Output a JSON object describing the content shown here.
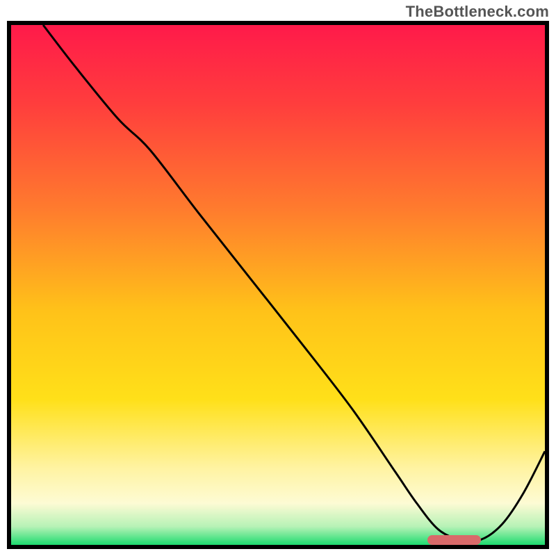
{
  "watermark": "TheBottleneck.com",
  "colors": {
    "frame": "#000000",
    "gradient_stops": [
      {
        "offset": 0.0,
        "color": "#ff1a4a"
      },
      {
        "offset": 0.15,
        "color": "#ff3d3d"
      },
      {
        "offset": 0.35,
        "color": "#ff7a2e"
      },
      {
        "offset": 0.55,
        "color": "#ffc219"
      },
      {
        "offset": 0.72,
        "color": "#ffe019"
      },
      {
        "offset": 0.85,
        "color": "#fff3a0"
      },
      {
        "offset": 0.92,
        "color": "#fdfbd4"
      },
      {
        "offset": 0.965,
        "color": "#b6f2b6"
      },
      {
        "offset": 1.0,
        "color": "#1ddb6f"
      }
    ],
    "curve": "#000000",
    "marker": "#d96a6a"
  },
  "chart_data": {
    "type": "line",
    "title": "",
    "xlabel": "",
    "ylabel": "",
    "xlim": [
      0,
      100
    ],
    "ylim": [
      0,
      100
    ],
    "grid": false,
    "legend": false,
    "series": [
      {
        "name": "bottleneck-curve",
        "x": [
          6,
          12,
          20,
          26,
          35,
          45,
          55,
          64,
          72,
          76,
          80,
          84,
          88,
          92,
          96,
          100
        ],
        "values": [
          100,
          92,
          82,
          76,
          64,
          51,
          38,
          26,
          14,
          8,
          3,
          1,
          1,
          4,
          10,
          18
        ]
      }
    ],
    "annotations": [
      {
        "name": "optimal-zone-marker",
        "type": "hband",
        "x0": 78,
        "x1": 88,
        "y": 1
      }
    ]
  }
}
